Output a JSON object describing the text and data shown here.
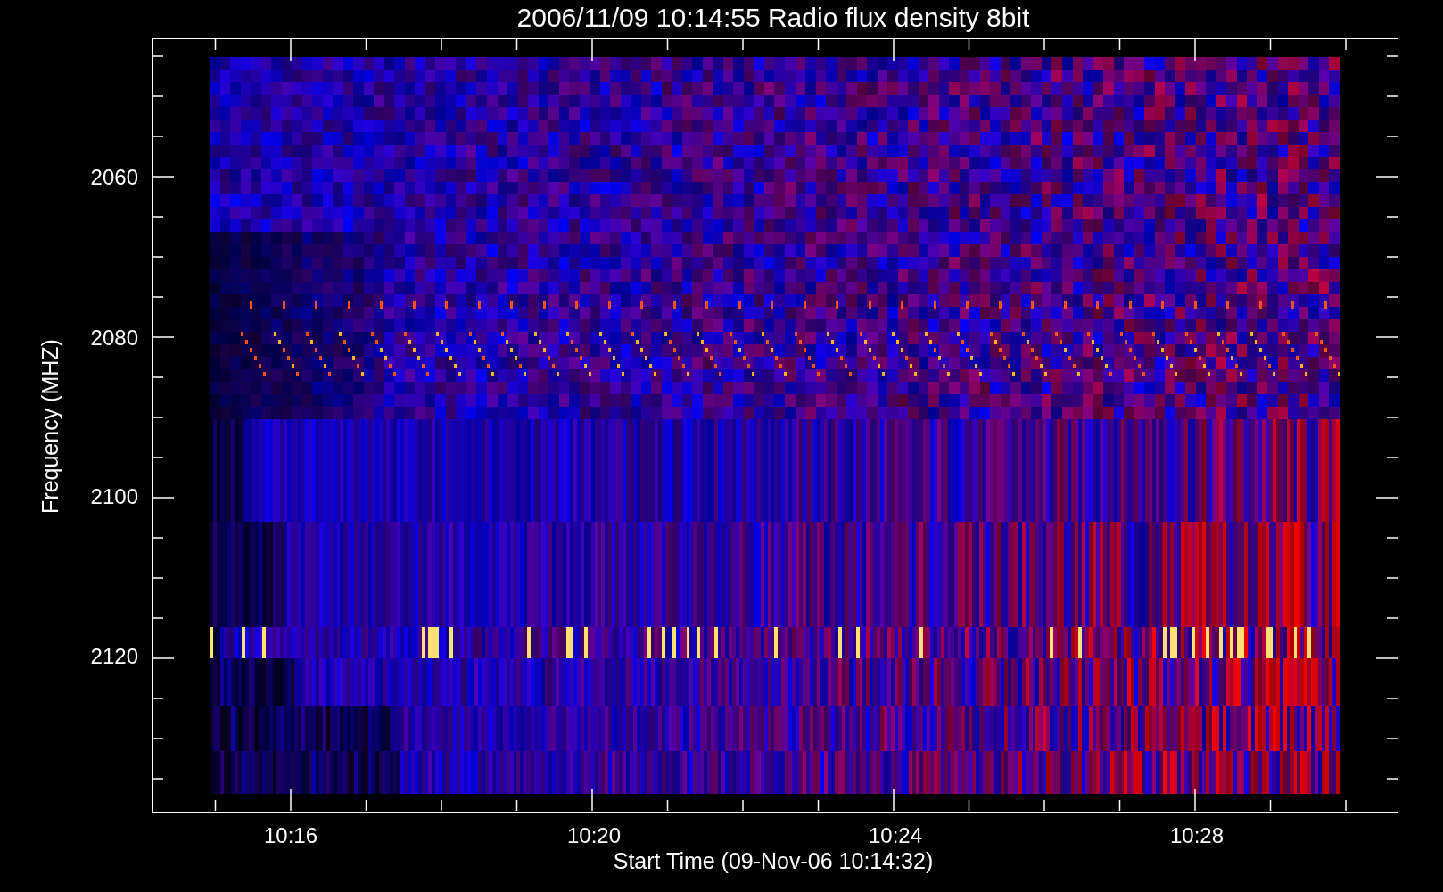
{
  "title": "2006/11/09 10:14:55 Radio flux density 8bit",
  "y_axis": {
    "label": "Frequency (MHZ)",
    "ticks": [
      "2060",
      "2080",
      "2100",
      "2120"
    ]
  },
  "x_axis": {
    "label": "Start Time (09-Nov-06 10:14:32)",
    "ticks": [
      "10:16",
      "10:20",
      "10:24",
      "10:28"
    ]
  }
}
